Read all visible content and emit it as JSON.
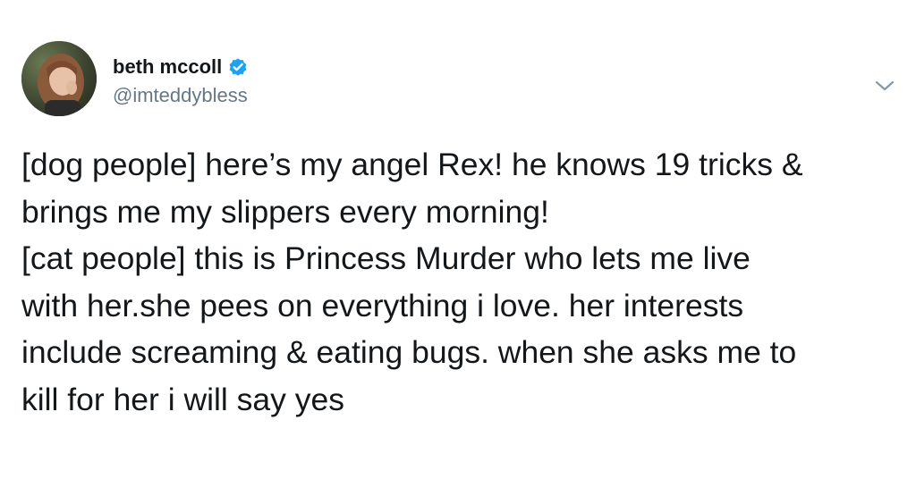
{
  "author": {
    "display_name": "beth mccoll",
    "handle": "@imteddybless",
    "verified": true,
    "avatar_icon": "user-avatar-photo"
  },
  "menu": {
    "icon": "chevron-down-icon"
  },
  "tweet": {
    "lines": [
      "[dog people] here’s my angel Rex! he knows 19 tricks &",
      "brings me my slippers every morning!",
      "[cat people] this is Princess Murder who lets me live",
      "with her.she pees on everything i love. her interests",
      "include screaming & eating bugs. when she asks me to",
      "kill for her i will say yes"
    ]
  },
  "colors": {
    "text": "#14171a",
    "secondary_text": "#657786",
    "verified_badge": "#1da1f2",
    "background": "#ffffff"
  }
}
